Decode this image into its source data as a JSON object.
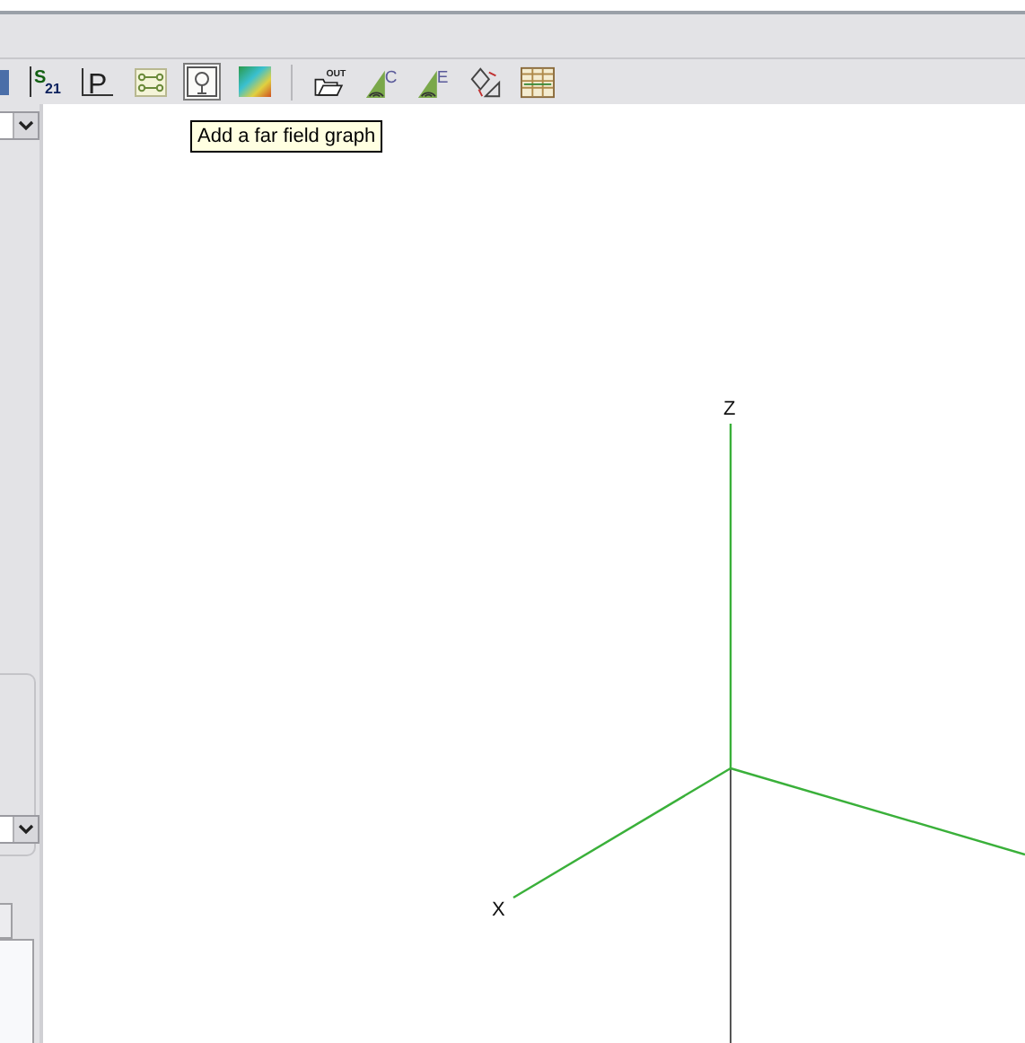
{
  "toolbar": [
    {
      "kind": "partial",
      "hovered": false
    },
    {
      "kind": "s-param",
      "glyph": "S",
      "sub": "21",
      "hovered": false
    },
    {
      "kind": "letter",
      "glyph": "P",
      "hovered": false
    },
    {
      "kind": "network",
      "hovered": false
    },
    {
      "kind": "far-field",
      "hovered": true
    },
    {
      "kind": "colormap",
      "hovered": false
    },
    {
      "kind": "separator"
    },
    {
      "kind": "export",
      "glyph": "OUT",
      "hovered": false
    },
    {
      "kind": "antenna",
      "glyph": "C",
      "hovered": false
    },
    {
      "kind": "antenna",
      "glyph": "E",
      "hovered": false
    },
    {
      "kind": "transform",
      "hovered": false
    },
    {
      "kind": "table",
      "hovered": false
    }
  ],
  "tooltip": "Add a far field graph",
  "axes": {
    "z_label": "Z",
    "x_label": "X"
  }
}
